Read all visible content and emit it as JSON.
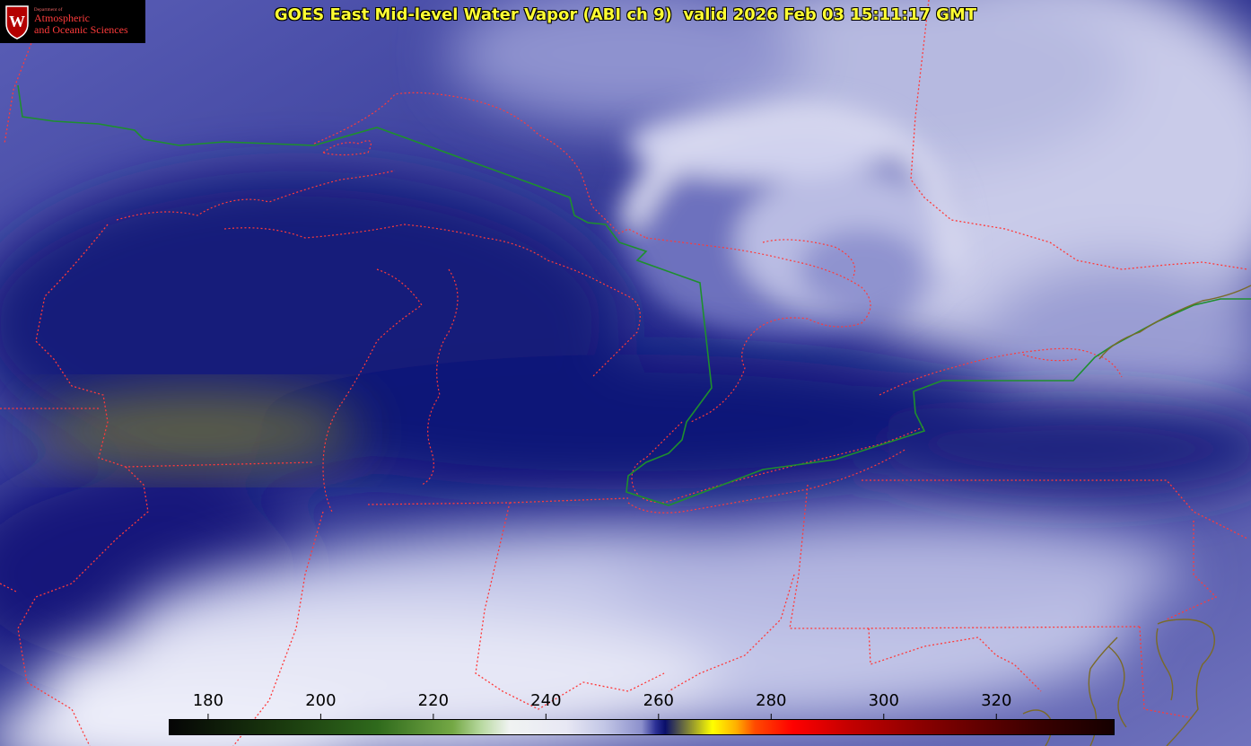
{
  "logo": {
    "dept": "Department of",
    "line1": "Atmospheric",
    "line2": "and Oceanic Sciences",
    "seal_letter": "W"
  },
  "title": "GOES East Mid-level Water Vapor (ABI ch 9)  valid 2026 Feb 03 15:11:17 GMT",
  "colorbar": {
    "ticks": [
      "180",
      "200",
      "220",
      "240",
      "260",
      "280",
      "300",
      "320"
    ],
    "min": 173,
    "max": 341
  },
  "colors": {
    "borders": "#ff3a3a",
    "international_border": "#1e8f2e",
    "coast": "#7a6a28",
    "title": "#ffff33"
  }
}
